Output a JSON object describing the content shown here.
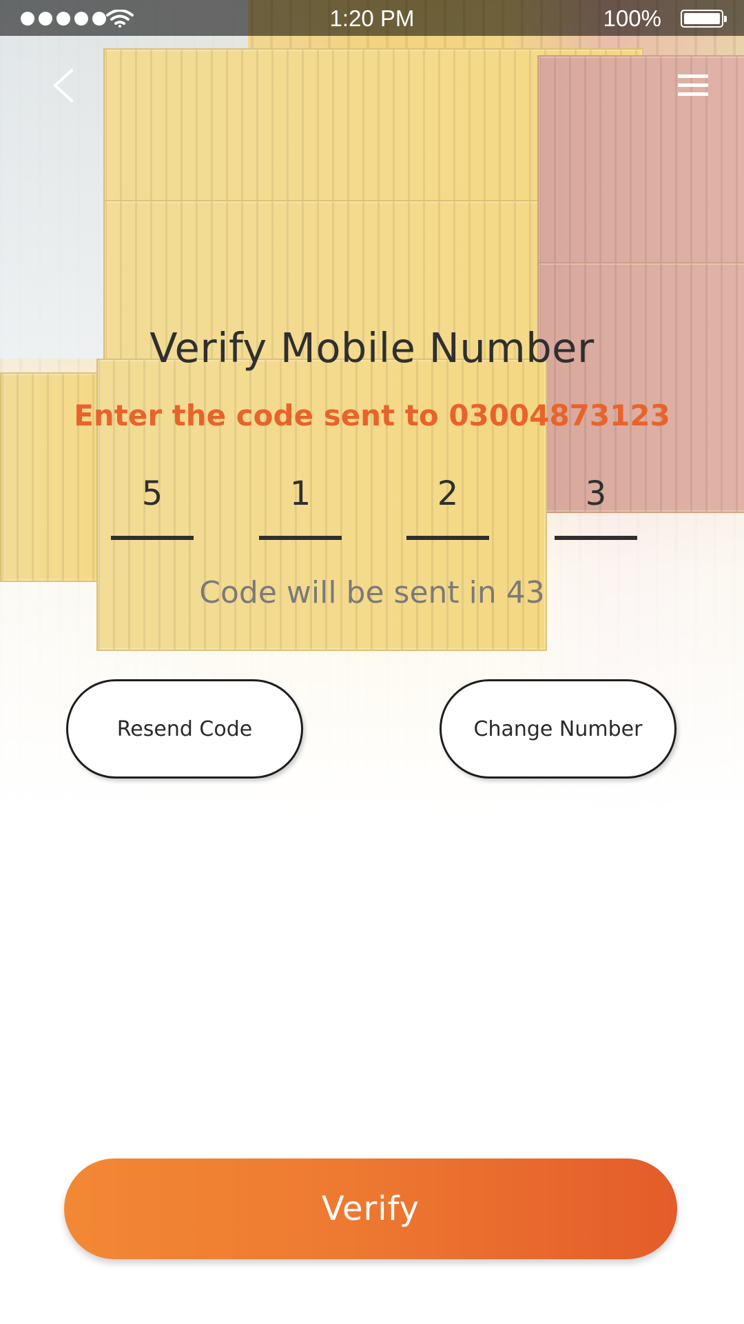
{
  "status_bar": {
    "time": "1:20 PM",
    "battery": "100%"
  },
  "page": {
    "title": "Verify Mobile Number",
    "subtitle": "Enter the code sent to 03004873123",
    "code_digits": [
      "5",
      "1",
      "2",
      "3"
    ],
    "countdown": "Code will be sent in 43"
  },
  "buttons": {
    "resend": "Resend Code",
    "change": "Change Number",
    "verify": "Verify"
  },
  "colors": {
    "accent_orange": "#e8632b",
    "verify_gradient_start": "#f28834",
    "verify_gradient_end": "#e45c2a",
    "text_dark": "#2f2f2f",
    "text_muted": "#7a7a7a"
  },
  "icons": {
    "back": "chevron-left-icon",
    "menu": "hamburger-menu-icon",
    "wifi": "wifi-icon",
    "battery": "battery-icon",
    "signal": "signal-icon"
  }
}
